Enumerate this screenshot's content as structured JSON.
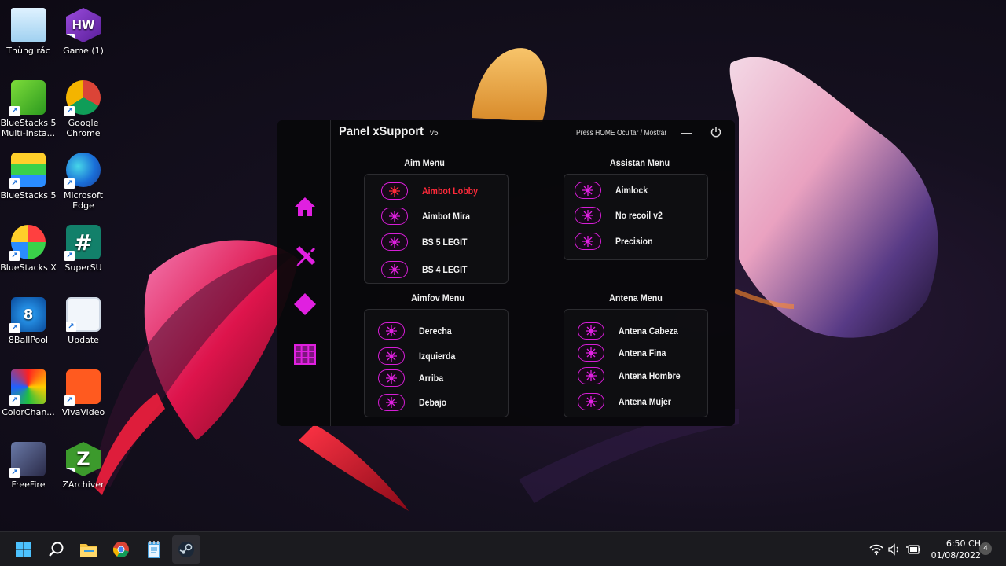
{
  "desktop": {
    "icons": [
      {
        "label": "Thùng rác",
        "icon": "recycle-bin-icon"
      },
      {
        "label": "Game (1)",
        "icon": "game-icon",
        "glyph": "HW"
      },
      {
        "label": "BlueStacks 5 Multi-Insta...",
        "icon": "bluestacks-multi-icon"
      },
      {
        "label": "Google Chrome",
        "icon": "chrome-icon"
      },
      {
        "label": "BlueStacks 5",
        "icon": "bluestacks-icon"
      },
      {
        "label": "Microsoft Edge",
        "icon": "edge-icon"
      },
      {
        "label": "BlueStacks X",
        "icon": "bluestacks-x-icon"
      },
      {
        "label": "SuperSU",
        "icon": "supersu-icon",
        "glyph": "#"
      },
      {
        "label": "8BallPool",
        "icon": "8ballpool-icon",
        "glyph": "8"
      },
      {
        "label": "Update",
        "icon": "update-icon"
      },
      {
        "label": "ColorChan...",
        "icon": "colorchanger-icon"
      },
      {
        "label": "VivaVideo",
        "icon": "vivavideo-icon"
      },
      {
        "label": "FreeFire",
        "icon": "freefire-icon"
      },
      {
        "label": "ZArchiver",
        "icon": "zarchiver-icon",
        "glyph": "Z"
      }
    ]
  },
  "panel": {
    "title": "Panel xSupport",
    "version": "v5",
    "hint": "Press HOME  Ocultar / Mostrar",
    "minimize": "—",
    "accent": "#e020e0",
    "sidebar": [
      {
        "icon": "home-icon"
      },
      {
        "icon": "tools-icon"
      },
      {
        "icon": "diamond-icon"
      },
      {
        "icon": "grid-icon"
      }
    ],
    "sections": [
      {
        "title": "Aim Menu",
        "items": [
          {
            "label": "Aimbot Lobby",
            "active": true
          },
          {
            "label": "Aimbot Mira",
            "active": false
          },
          {
            "label": "BS 5 LEGIT",
            "active": false
          },
          {
            "label": "BS 4 LEGIT",
            "active": false
          }
        ]
      },
      {
        "title": "Assistan Menu",
        "items": [
          {
            "label": "Aimlock",
            "active": false
          },
          {
            "label": "No recoil v2",
            "active": false
          },
          {
            "label": "Precision",
            "active": false
          }
        ]
      },
      {
        "title": "Aimfov Menu",
        "items": [
          {
            "label": "Derecha",
            "active": false
          },
          {
            "label": "Izquierda",
            "active": false
          },
          {
            "label": "Arriba",
            "active": false
          },
          {
            "label": "Debajo",
            "active": false
          }
        ]
      },
      {
        "title": "Antena Menu",
        "items": [
          {
            "label": "Antena Cabeza",
            "active": false
          },
          {
            "label": "Antena Fina",
            "active": false
          },
          {
            "label": "Antena Hombre",
            "active": false
          },
          {
            "label": "Antena Mujer",
            "active": false
          }
        ]
      }
    ]
  },
  "taskbar": {
    "apps": [
      {
        "icon": "windows-start-icon"
      },
      {
        "icon": "search-icon"
      },
      {
        "icon": "file-explorer-icon"
      },
      {
        "icon": "chrome-icon"
      },
      {
        "icon": "notepad-icon"
      },
      {
        "icon": "steam-icon"
      }
    ],
    "tray": [
      {
        "icon": "wifi-icon"
      },
      {
        "icon": "volume-icon"
      },
      {
        "icon": "battery-icon"
      }
    ],
    "time": "6:50 CH",
    "date": "01/08/2022",
    "notifications": "4"
  }
}
